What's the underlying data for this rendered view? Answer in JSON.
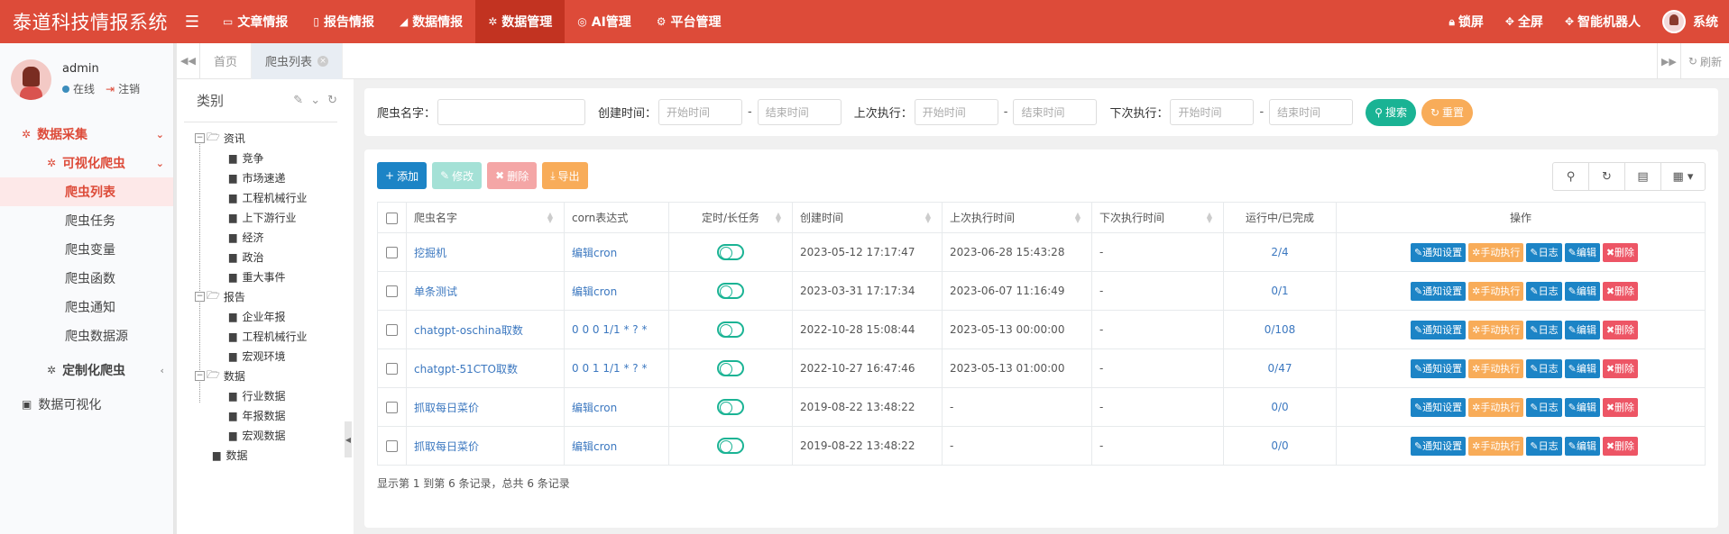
{
  "app": {
    "title": "泰道科技情报系统",
    "menu_icon": "bars-icon"
  },
  "topmenu": [
    {
      "icon": "desktop-icon",
      "label": "文章情报"
    },
    {
      "icon": "file-pdf-icon",
      "label": "报告情报"
    },
    {
      "icon": "area-chart-icon",
      "label": "数据情报"
    },
    {
      "icon": "bug-icon",
      "label": "数据管理",
      "active": true
    },
    {
      "icon": "globe-icon",
      "label": "AI管理"
    },
    {
      "icon": "gear-icon",
      "label": "平台管理"
    }
  ],
  "topright": {
    "lock": "锁屏",
    "fullscreen": "全屏",
    "robot": "智能机器人",
    "user": "系统"
  },
  "user": {
    "name": "admin",
    "status": "在线",
    "logout": "注销"
  },
  "sidebar": {
    "collect": "数据采集",
    "visual_crawler": "可视化爬虫",
    "items": [
      "爬虫列表",
      "爬虫任务",
      "爬虫变量",
      "爬虫函数",
      "爬虫通知",
      "爬虫数据源"
    ],
    "custom_crawler": "定制化爬虫",
    "data_visual": "数据可视化"
  },
  "tabs": {
    "home": "首页",
    "current": "爬虫列表",
    "refresh": "刷新"
  },
  "category": {
    "title": "类别",
    "tree": {
      "g1": "资讯",
      "g1_items": [
        "竞争",
        "市场速递",
        "工程机械行业",
        "上下游行业",
        "经济",
        "政治",
        "重大事件"
      ],
      "g2": "报告",
      "g2_items": [
        "企业年报",
        "工程机械行业",
        "宏观环境"
      ],
      "g3": "数据",
      "g3_items": [
        "行业数据",
        "年报数据",
        "宏观数据"
      ],
      "leaf": "数据"
    }
  },
  "search": {
    "name_label": "爬虫名字：",
    "create_label": "创建时间：",
    "last_label": "上次执行：",
    "next_label": "下次执行：",
    "start_ph": "开始时间",
    "end_ph": "结束时间",
    "search_btn": "搜索",
    "reset_btn": "重置"
  },
  "toolbar": {
    "add": "添加",
    "edit": "修改",
    "del": "删除",
    "export": "导出"
  },
  "table": {
    "headers": {
      "name": "爬虫名字",
      "cron": "corn表达式",
      "timer": "定时/长任务",
      "created": "创建时间",
      "last": "上次执行时间",
      "next": "下次执行时间",
      "running": "运行中/已完成",
      "ops": "操作"
    },
    "op_labels": {
      "notify": "通知设置",
      "manual": "手动执行",
      "log": "日志",
      "edit": "编辑",
      "del": "删除"
    },
    "rows": [
      {
        "name": "挖掘机",
        "cron": "编辑cron",
        "created": "2023-05-12 17:17:47",
        "last": "2023-06-28 15:43:28",
        "next": "-",
        "running": "2/4"
      },
      {
        "name": "单条测试",
        "cron": "编辑cron",
        "created": "2023-03-31 17:17:34",
        "last": "2023-06-07 11:16:49",
        "next": "-",
        "running": "0/1"
      },
      {
        "name": "chatgpt-oschina取数",
        "cron": "0 0 0 1/1 * ? *",
        "created": "2022-10-28 15:08:44",
        "last": "2023-05-13 00:00:00",
        "next": "-",
        "running": "0/108"
      },
      {
        "name": "chatgpt-51CTO取数",
        "cron": "0 0 1 1/1 * ? *",
        "created": "2022-10-27 16:47:46",
        "last": "2023-05-13 01:00:00",
        "next": "-",
        "running": "0/47"
      },
      {
        "name": "抓取每日菜价",
        "cron": "编辑cron",
        "created": "2019-08-22 13:48:22",
        "last": "-",
        "next": "-",
        "running": "0/0"
      },
      {
        "name": "抓取每日菜价",
        "cron": "编辑cron",
        "created": "2019-08-22 13:48:22",
        "last": "-",
        "next": "-",
        "running": "0/0"
      }
    ],
    "footer": "显示第 1 到第 6 条记录，总共 6 条记录"
  },
  "colors": {
    "brand": "#dd4b39",
    "primary": "#1c84c6",
    "success": "#1ab394",
    "warning": "#f8ac59",
    "danger": "#ed5565"
  }
}
